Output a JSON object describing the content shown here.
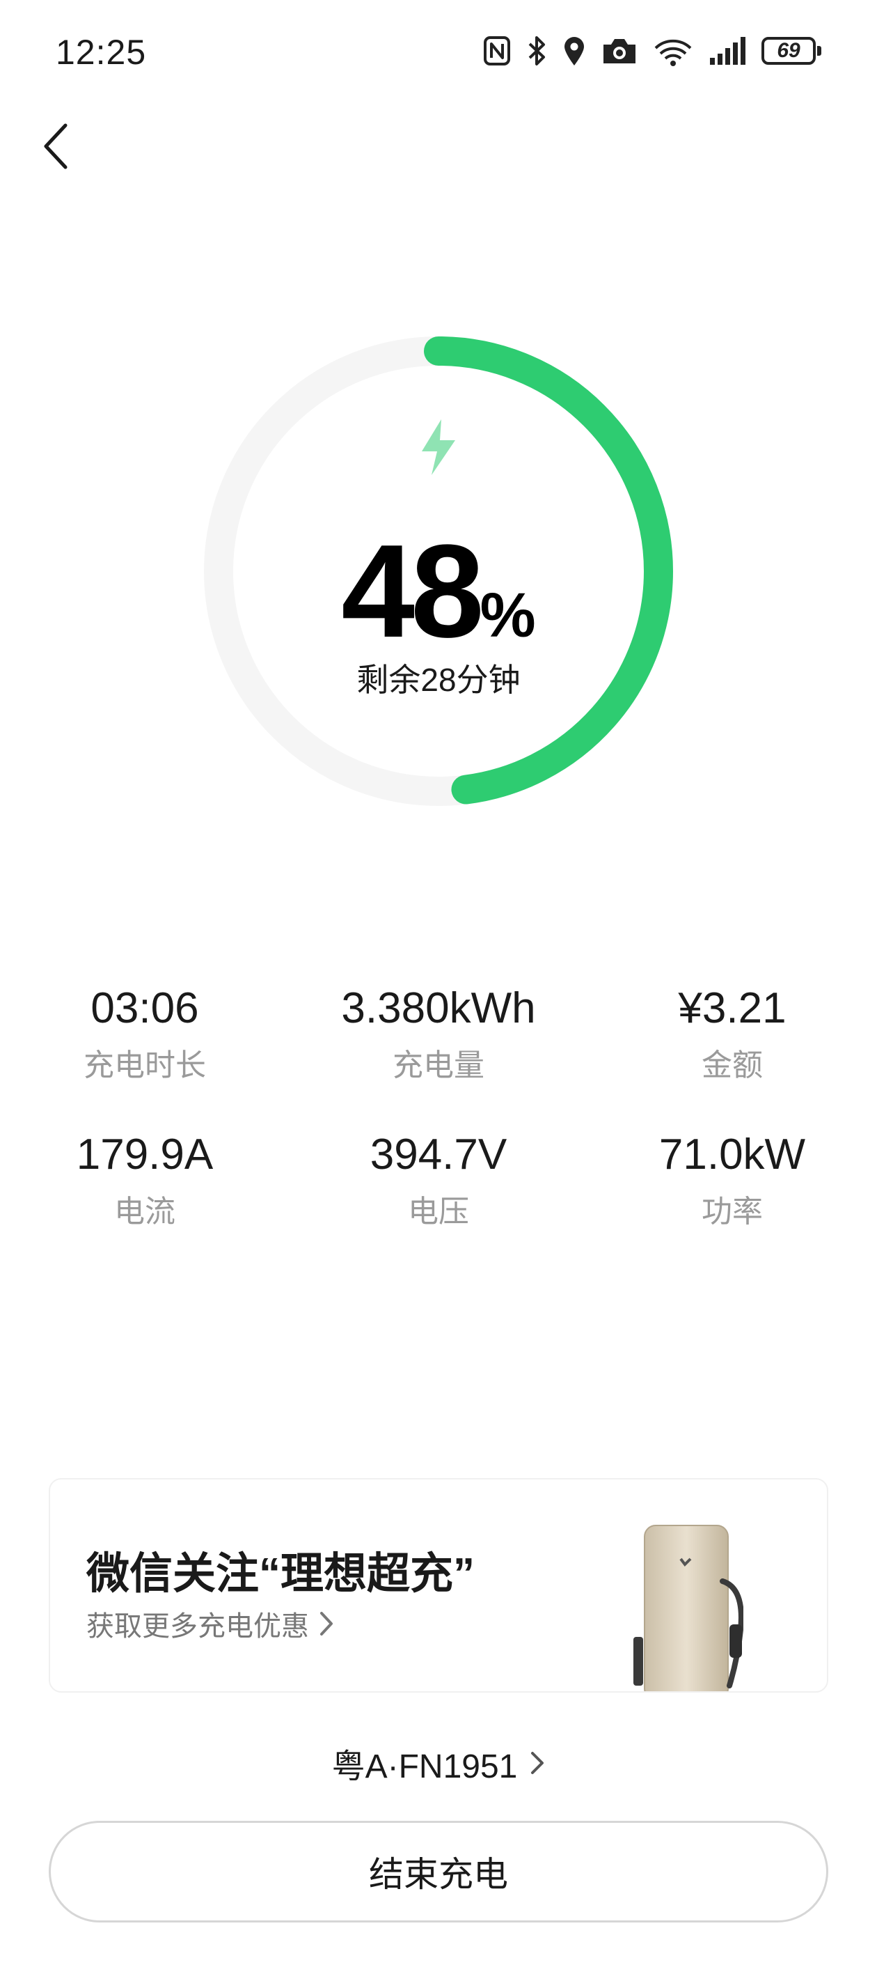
{
  "status_bar": {
    "time": "12:25",
    "battery": "69",
    "icons": [
      "nfc-icon",
      "bluetooth-icon",
      "location-icon",
      "camera-icon",
      "wifi-icon",
      "signal-icon",
      "battery-icon"
    ]
  },
  "header": {
    "back_icon": "chevron-left-icon"
  },
  "charge": {
    "percent": "48",
    "percent_sign": "%",
    "progress_fraction": 0.48,
    "remaining": "剩余28分钟",
    "accent_color": "#2ecc71",
    "track_color": "#f5f5f5"
  },
  "stats": [
    {
      "value": "03:06",
      "label": "充电时长"
    },
    {
      "value": "3.380kWh",
      "label": "充电量"
    },
    {
      "value": "¥3.21",
      "label": "金额"
    },
    {
      "value": "179.9A",
      "label": "电流"
    },
    {
      "value": "394.7V",
      "label": "电压"
    },
    {
      "value": "71.0kW",
      "label": "功率"
    }
  ],
  "promo": {
    "title": "微信关注“理想超充”",
    "subtitle": "获取更多充电优惠"
  },
  "vehicle": {
    "plate": "粤A·FN1951"
  },
  "actions": {
    "end_label": "结束充电"
  }
}
